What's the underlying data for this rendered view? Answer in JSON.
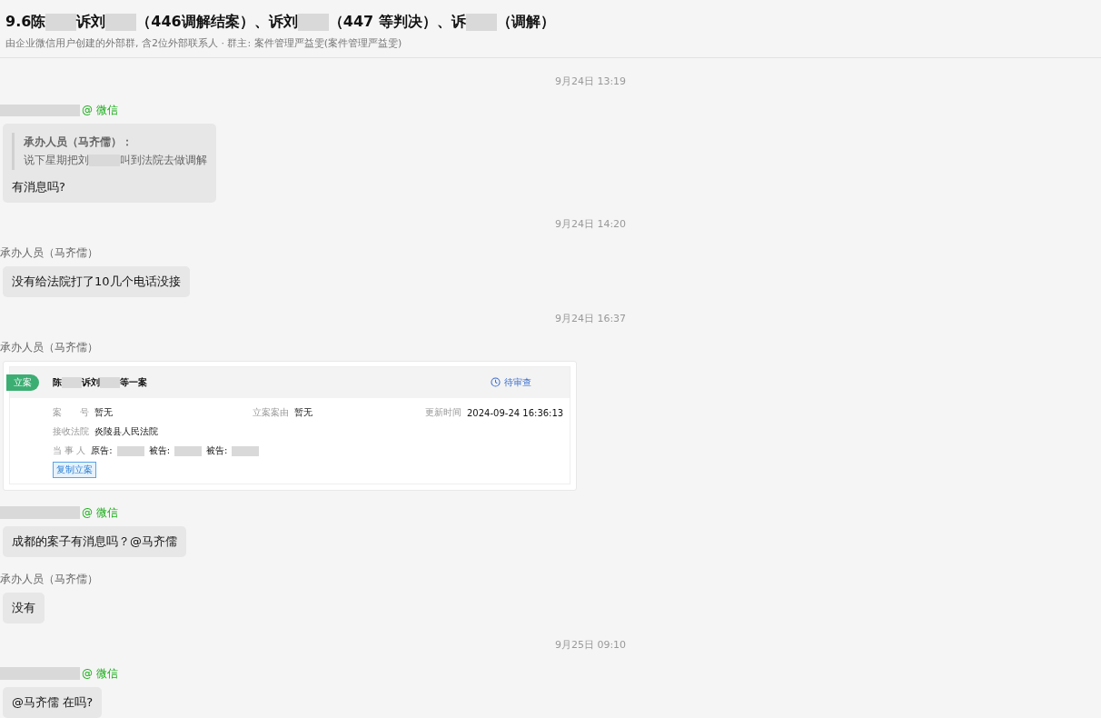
{
  "header": {
    "title_parts": [
      {
        "kind": "text",
        "text": "9.6陈"
      },
      {
        "kind": "redacted"
      },
      {
        "kind": "text",
        "text": "诉刘"
      },
      {
        "kind": "redacted"
      },
      {
        "kind": "text",
        "text": "（446调解结案）、诉刘"
      },
      {
        "kind": "redacted"
      },
      {
        "kind": "text",
        "text": "（447 等判决）、诉"
      },
      {
        "kind": "redacted"
      },
      {
        "kind": "text",
        "text": "（调解）"
      }
    ],
    "subtitle": "由企业微信用户创建的外部群, 含2位外部联系人 · 群主: 案件管理严益雯(案件管理严益雯)"
  },
  "messages": [
    {
      "kind": "time",
      "text": "9月24日 13:19"
    },
    {
      "kind": "message",
      "sender_parts": [
        {
          "kind": "redacted"
        }
      ],
      "tag": "@ 微信",
      "quote": {
        "author": "承办人员（马齐儒）：",
        "parts": [
          {
            "kind": "text",
            "text": "说下星期把刘"
          },
          {
            "kind": "redacted"
          },
          {
            "kind": "text",
            "text": "叫到法院去做调解"
          }
        ]
      },
      "text": "有消息吗?"
    },
    {
      "kind": "time",
      "text": "9月24日 14:20"
    },
    {
      "kind": "message",
      "sender_parts": [
        {
          "kind": "text",
          "text": "承办人员（马齐儒）"
        }
      ],
      "text": "没有给法院打了10几个电话没接"
    },
    {
      "kind": "time",
      "text": "9月24日 16:37"
    },
    {
      "kind": "card",
      "sender_parts": [
        {
          "kind": "text",
          "text": "承办人员（马齐儒）"
        }
      ],
      "card": {
        "tag": "立案",
        "title_parts": [
          {
            "kind": "text",
            "text": "陈"
          },
          {
            "kind": "redacted"
          },
          {
            "kind": "text",
            "text": "诉刘"
          },
          {
            "kind": "redacted"
          },
          {
            "kind": "text",
            "text": "等一案"
          }
        ],
        "status": "待审查",
        "fields": [
          {
            "label": "案　　号",
            "parts": [
              {
                "kind": "text",
                "text": "暂无"
              }
            ]
          },
          {
            "label": "立案案由",
            "parts": [
              {
                "kind": "text",
                "text": "暂无"
              }
            ]
          },
          {
            "label": "更新时间",
            "parts": [
              {
                "kind": "text",
                "text": "2024-09-24 16:36:13"
              }
            ]
          },
          {
            "label": "接收法院",
            "parts": [
              {
                "kind": "text",
                "text": "炎陵县人民法院"
              }
            ]
          },
          {
            "label": "当 事 人",
            "parts": [
              {
                "kind": "text",
                "text": "原告:"
              },
              {
                "kind": "redacted"
              },
              {
                "kind": "text",
                "text": "被告:"
              },
              {
                "kind": "redacted"
              },
              {
                "kind": "text",
                "text": "被告:"
              },
              {
                "kind": "redacted"
              }
            ]
          }
        ],
        "button": "复制立案"
      }
    },
    {
      "kind": "message",
      "sender_parts": [
        {
          "kind": "redacted"
        }
      ],
      "tag": "@ 微信",
      "text": "成都的案子有消息吗？@马齐儒"
    },
    {
      "kind": "message",
      "sender_parts": [
        {
          "kind": "text",
          "text": "承办人员（马齐儒）"
        }
      ],
      "text": "没有"
    },
    {
      "kind": "time",
      "text": "9月25日 09:10"
    },
    {
      "kind": "message",
      "sender_parts": [
        {
          "kind": "redacted"
        }
      ],
      "tag": "@ 微信",
      "text": "@马齐儒 在吗?"
    }
  ]
}
